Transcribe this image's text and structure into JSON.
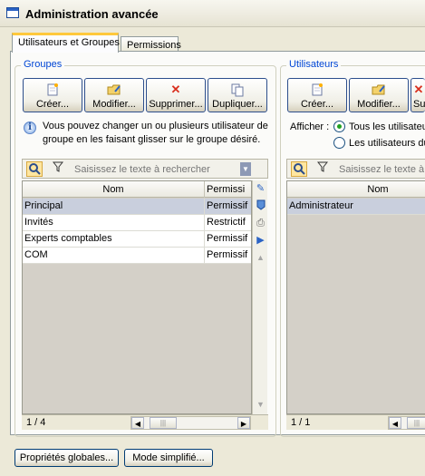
{
  "window": {
    "title": "Administration avancée",
    "icon": "window-icon"
  },
  "tabs": [
    {
      "label": "Utilisateurs et Groupes",
      "active": true
    },
    {
      "label": "Permissions",
      "active": false
    }
  ],
  "groups_panel": {
    "title": "Groupes",
    "toolbar": [
      {
        "label": "Créer...",
        "icon": "new-document-icon"
      },
      {
        "label": "Modifier...",
        "icon": "edit-folder-icon"
      },
      {
        "label": "Supprimer...",
        "icon": "delete-icon"
      },
      {
        "label": "Dupliquer...",
        "icon": "duplicate-icon"
      }
    ],
    "info_line1": "Vous pouvez changer un ou plusieurs utilisateur de",
    "info_line2": "groupe en les faisant glisser sur le groupe désiré.",
    "search_placeholder": "Saisissez le texte à rechercher",
    "columns": [
      "Nom",
      "Permissi"
    ],
    "rows": [
      {
        "nom": "Principal",
        "perm": "Permissif",
        "selected": true
      },
      {
        "nom": "Invités",
        "perm": "Restrictif",
        "selected": false
      },
      {
        "nom": "Experts comptables",
        "perm": "Permissif",
        "selected": false
      },
      {
        "nom": "COM",
        "perm": "Permissif",
        "selected": false
      }
    ],
    "count": "1 / 4"
  },
  "users_panel": {
    "title": "Utilisateurs",
    "toolbar": [
      {
        "label": "Créer...",
        "icon": "new-document-icon"
      },
      {
        "label": "Modifier...",
        "icon": "edit-folder-icon"
      },
      {
        "label": "Su",
        "icon": "delete-icon"
      }
    ],
    "afficher_label": "Afficher :",
    "radio1": "Tous les utilisateu",
    "radio2": "Les utilisateurs du",
    "search_placeholder": "Saisissez le texte à r",
    "columns": [
      "Nom"
    ],
    "rows": [
      {
        "nom": "Administrateur",
        "selected": true
      }
    ],
    "count": "1 / 1"
  },
  "bottom_buttons": {
    "global_props": "Propriétés globales...",
    "simple_mode": "Mode simplifié..."
  },
  "colors": {
    "accent_tab": "#ffc83c",
    "group_title": "#0046d5",
    "selected_row": "#c9cfdd"
  }
}
